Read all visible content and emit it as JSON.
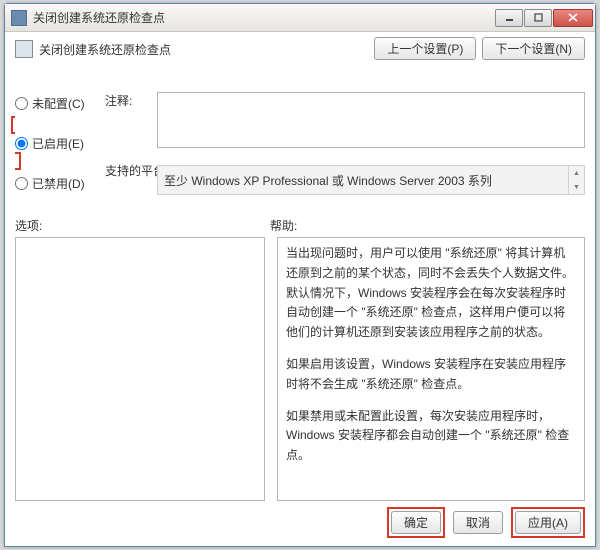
{
  "window": {
    "title": "关闭创建系统还原检查点"
  },
  "header": {
    "heading": "关闭创建系统还原检查点"
  },
  "nav": {
    "prev": "上一个设置(P)",
    "next": "下一个设置(N)"
  },
  "radios": {
    "not_configured": "未配置(C)",
    "enabled": "已启用(E)",
    "disabled": "已禁用(D)",
    "selected": "enabled"
  },
  "labels": {
    "comment": "注释:",
    "platform": "支持的平台:"
  },
  "fields": {
    "comment_value": "",
    "platform_value": "至少 Windows XP Professional 或 Windows Server 2003 系列"
  },
  "section": {
    "options": "选项:",
    "help": "帮助:"
  },
  "help": {
    "p1": "当出现问题时，用户可以使用 \"系统还原\" 将其计算机还原到之前的某个状态，同时不会丢失个人数据文件。默认情况下，Windows 安装程序会在每次安装程序时自动创建一个 \"系统还原\" 检查点，这样用户便可以将他们的计算机还原到安装该应用程序之前的状态。",
    "p2": "如果启用该设置，Windows 安装程序在安装应用程序时将不会生成 \"系统还原\" 检查点。",
    "p3": "如果禁用或未配置此设置，每次安装应用程序时，Windows 安装程序都会自动创建一个 \"系统还原\" 检查点。"
  },
  "footer": {
    "ok": "确定",
    "cancel": "取消",
    "apply": "应用(A)"
  }
}
